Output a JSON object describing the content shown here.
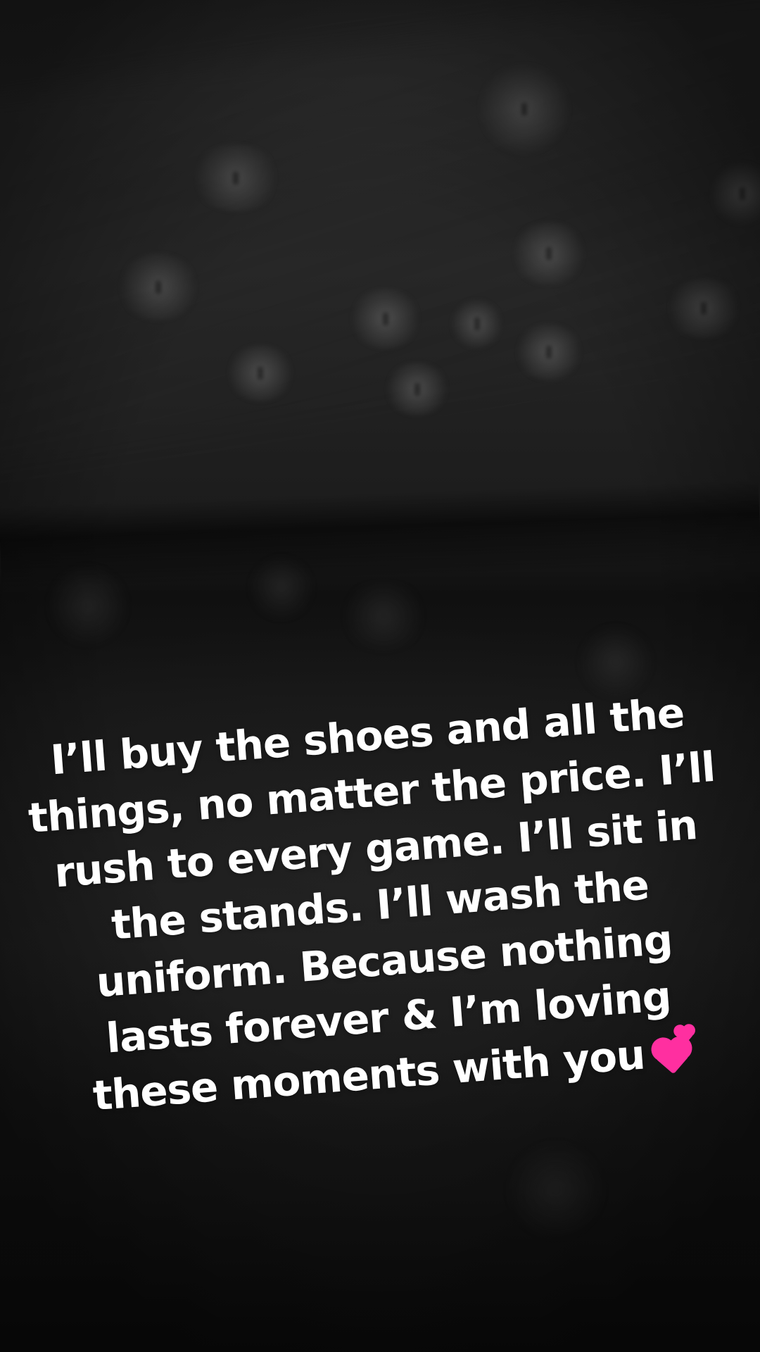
{
  "caption": {
    "lines": [
      "I’ll buy the shoes and all the",
      "things, no matter the price. I’ll",
      "rush to every game. I’ll sit in",
      "the stands. I’ll wash the",
      "uniform. Because nothing",
      "lasts forever & I’m loving",
      "these moments with you"
    ],
    "emoji": "two-hearts",
    "text_color": "#ffffff",
    "emoji_color": "#ff2fa0"
  }
}
